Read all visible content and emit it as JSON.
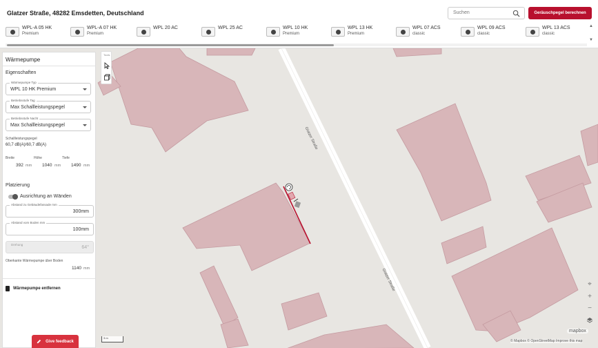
{
  "header": {
    "address": "Glatzer Straße, 48282 Emsdetten, Deutschland",
    "search_placeholder": "Suchen",
    "calc_button": "Geräuschpegel berechnen"
  },
  "products": [
    {
      "name": "WPL-A 05 HK",
      "sub": "Premium"
    },
    {
      "name": "WPL-A 07 HK",
      "sub": "Premium"
    },
    {
      "name": "WPL 20 AC",
      "sub": ""
    },
    {
      "name": "WPL 25 AC",
      "sub": ""
    },
    {
      "name": "WPL 10 HK",
      "sub": "Premium"
    },
    {
      "name": "WPL 13 HK",
      "sub": "Premium"
    },
    {
      "name": "WPL 07 ACS",
      "sub": "classic"
    },
    {
      "name": "WPL 09 ACS",
      "sub": "classic"
    },
    {
      "name": "WPL 13 ACS",
      "sub": "classic"
    }
  ],
  "panel": {
    "title": "Wärmepumpe",
    "properties_title": "Eigenschaften",
    "type_label": "Wärmepumpe Typ",
    "type_value": "WPL 10 HK Premium",
    "day_label": "Betriebsstufe Tag",
    "day_value": "Max Schallleistungspegel",
    "night_label": "Betriebsstufe Nacht",
    "night_value": "Max Schallleistungspegel",
    "sound_label": "Schallleistungspegel",
    "sound_value": "60,7 dB(A)/60,7 dB(A)",
    "width_label": "Breite",
    "width_value": "392",
    "height_label": "Höhe",
    "height_value": "1040",
    "depth_label": "Tiefe",
    "depth_value": "1490",
    "unit_mm": "mm",
    "placement_title": "Platzierung",
    "align_label": "Ausrichtung an Wänden",
    "facade_label": "Abstand zu Gebäudefassade mm",
    "facade_value": "300mm",
    "floor_label": "Abstand vom Boden mm",
    "floor_value": "100mm",
    "rotation_label": "Drehung",
    "rotation_value": "64°",
    "top_edge_label": "Oberkante Wärmepumpe über Boden",
    "top_edge_value": "1140",
    "remove_label": "Wärmepumpe entfernen"
  },
  "toolbar": {
    "label": "Tools"
  },
  "map": {
    "street_label": "Glatzer Straße",
    "scale": "3 m",
    "attribution": "© Mapbox © OpenStreetMap  Improve this map",
    "logo": "mapbox"
  },
  "feedback": "Give feedback",
  "colors": {
    "brand": "#b8102e",
    "building": "#d9b8ba",
    "building_stroke": "#c79ea2",
    "selected_wall": "#b8102e"
  }
}
